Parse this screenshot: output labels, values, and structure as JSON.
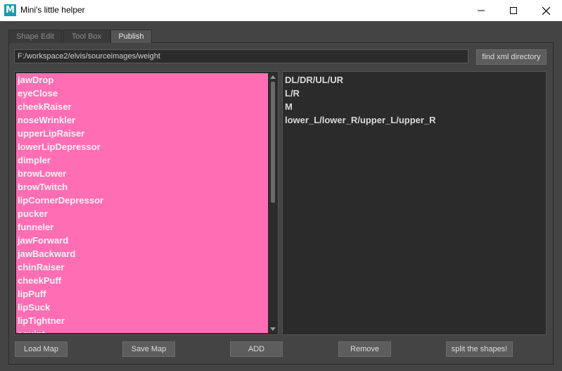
{
  "window": {
    "title": "Mini's little helper",
    "app_icon_letter": "M",
    "controls": [
      "minimize-icon",
      "maximize-icon",
      "close-icon"
    ]
  },
  "tabs": [
    {
      "label": "Shape Edit",
      "active": false
    },
    {
      "label": "Tool Box",
      "active": false
    },
    {
      "label": "Publish",
      "active": true
    }
  ],
  "path_field": {
    "value": "F:/workspace2/elvis/sourceimages/weight"
  },
  "buttons": {
    "find_xml": "find xml directory",
    "load_map": "Load Map",
    "save_map": "Save Map",
    "add": "ADD",
    "remove": "Remove",
    "split": "split the shapes!"
  },
  "left_list": {
    "highlight_color": "#ff6eb4",
    "items": [
      "jawDrop",
      "eyeClose",
      "cheekRaiser",
      "noseWrinkler",
      "upperLipRaiser",
      "lowerLipDepressor",
      "dimpler",
      "browLower",
      "browTwitch",
      "lipCornerDepressor",
      "pucker",
      "funneler",
      "jawForward",
      "jawBackward",
      "chinRaiser",
      "cheekPuff",
      "lipPuff",
      "lipSuck",
      "lipTightner",
      "squint"
    ]
  },
  "right_list": {
    "items": [
      "DL/DR/UL/UR",
      "L/R",
      "M",
      "lower_L/lower_R/upper_L/upper_R"
    ]
  },
  "colors": {
    "background": "#444444",
    "list_background": "#2b2b2b",
    "active_tab": "#555555"
  }
}
